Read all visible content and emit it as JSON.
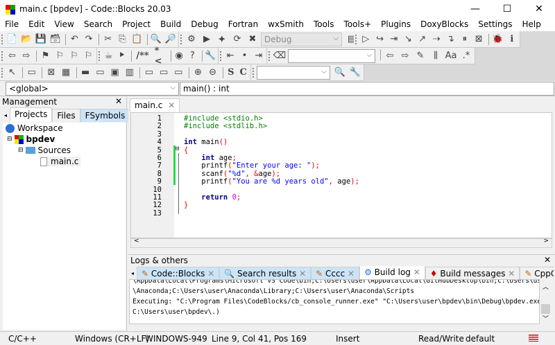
{
  "window": {
    "title": "main.c [bpdev] - Code::Blocks 20.03",
    "minimize": "—",
    "maximize": "☐",
    "close": "✕"
  },
  "menu": [
    "File",
    "Edit",
    "View",
    "Search",
    "Project",
    "Build",
    "Debug",
    "Fortran",
    "wxSmith",
    "Tools",
    "Tools+",
    "Plugins",
    "DoxyBlocks",
    "Settings",
    "Help"
  ],
  "toolbars": {
    "row1a": [
      [
        "new-file-icon",
        "📄"
      ],
      [
        "open-icon",
        "📂"
      ],
      [
        "save-icon",
        "💾"
      ],
      [
        "save-all-icon",
        "🗃"
      ],
      "|",
      [
        "undo-icon",
        "↶"
      ],
      [
        "redo-icon",
        "↷"
      ],
      "|",
      [
        "cut-icon",
        "✂"
      ],
      [
        "copy-icon",
        "⎘"
      ],
      [
        "paste-icon",
        "📋"
      ],
      "|",
      [
        "find-icon",
        "🔍"
      ],
      [
        "replace-icon",
        "🔎"
      ]
    ],
    "row1b": [
      [
        "build-icon",
        "⚙"
      ],
      [
        "run-icon",
        "▶"
      ],
      [
        "build-run-icon",
        "⯌"
      ],
      [
        "rebuild-icon",
        "⟳"
      ],
      [
        "abort-icon",
        "✖"
      ]
    ],
    "build_target": "Debug",
    "row1c": [
      [
        "show-target-icon",
        "▤"
      ]
    ],
    "row1d": [
      [
        "debug-start-icon",
        "▷"
      ],
      [
        "run-to-cursor-icon",
        "↪"
      ],
      [
        "next-line-icon",
        "⇥"
      ],
      [
        "step-into-icon",
        "↘"
      ],
      [
        "step-out-icon",
        "↗"
      ],
      [
        "next-instruction-icon",
        "⇢"
      ],
      [
        "step-into-instruction-icon",
        "↴"
      ],
      [
        "pause-icon",
        "⏸"
      ],
      [
        "stop-debug-icon",
        "⊠"
      ],
      "|",
      [
        "debug-windows-icon",
        "🐞"
      ],
      [
        "info-icon",
        "ℹ"
      ]
    ],
    "row2a": [
      [
        "back-icon",
        "⇦"
      ],
      [
        "forward-icon",
        "⇨"
      ],
      "|",
      [
        "bookmark-toggle-icon",
        "⚑"
      ],
      [
        "bookmark-prev-icon",
        "⚐"
      ],
      [
        "bookmark-next-icon",
        "⚐"
      ],
      [
        "bookmark-clear-icon",
        "⚐"
      ]
    ],
    "row2b": [
      [
        "doxywizard-icon",
        "☕"
      ],
      [
        "extract-docs-icon",
        "⯈"
      ],
      "|",
      [
        "block-comment-label",
        "/**"
      ],
      [
        "line-comment-label",
        "*<"
      ],
      "|",
      [
        "run-html-icon",
        "◉"
      ],
      [
        "run-chm-icon",
        "?"
      ],
      "|",
      [
        "config-icon",
        "🔧"
      ]
    ],
    "row2c": [
      [
        "jump-prev-icon",
        "⇤"
      ],
      [
        "jump-dot-icon",
        "•"
      ],
      [
        "jump-next-icon",
        "⇥"
      ]
    ],
    "row2d": [
      [
        "tag-icon",
        "⌫"
      ]
    ],
    "row2e": [
      "|",
      [
        "search-back-icon",
        "⇦"
      ],
      [
        "search-forward-icon",
        "⇨"
      ],
      [
        "highlight-icon",
        "✎"
      ],
      [
        "selected-text-icon",
        "⫼"
      ],
      [
        "match-case-icon",
        "Aa"
      ],
      [
        "regex-icon",
        ".*"
      ]
    ],
    "row3a": [
      [
        "pointer-icon",
        "↖"
      ],
      "|",
      [
        "frame-icon",
        "▭"
      ],
      "|",
      [
        "static-box-icon",
        "⊠"
      ],
      [
        "grid-icon",
        "▦"
      ],
      "|",
      [
        "panel1-icon",
        "▬"
      ],
      [
        "panel2-icon",
        "▭"
      ],
      [
        "panel3-icon",
        "▣"
      ],
      [
        "panel4-icon",
        "▥"
      ],
      "|",
      [
        "sizer1-icon",
        "▭"
      ],
      [
        "sizer2-icon",
        "▭"
      ],
      [
        "sizer3-icon",
        "▭"
      ],
      "|",
      [
        "zoom-in-icon",
        "⊕"
      ],
      [
        "zoom-out-icon",
        "⊖"
      ],
      "|",
      [
        "s-label",
        "S"
      ],
      [
        "c-label",
        "C"
      ]
    ],
    "row3b": [
      [
        "search-symbol-icon",
        "🔍"
      ],
      [
        "settings-wrench-icon",
        "🔧"
      ]
    ]
  },
  "codecompletion": {
    "scope": "<global>",
    "function": "main() : int"
  },
  "management": {
    "title": "Management",
    "tabs": [
      "Projects",
      "Files",
      "FSymbols"
    ],
    "tree": {
      "workspace": "Workspace",
      "project": "bpdev",
      "folder": "Sources",
      "file": "main.c"
    }
  },
  "editor": {
    "tab": "main.c",
    "lines": [
      [
        [
          "pp",
          "#include <stdio.h>"
        ]
      ],
      [
        [
          "pp",
          "#include <stdlib.h>"
        ]
      ],
      [],
      [
        [
          "k",
          "int"
        ],
        [
          "t",
          " main"
        ],
        [
          "o",
          "()"
        ]
      ],
      [
        [
          "o",
          "{"
        ]
      ],
      [
        [
          "t",
          "    "
        ],
        [
          "k",
          "int"
        ],
        [
          "t",
          " age"
        ],
        [
          "o",
          ";"
        ]
      ],
      [
        [
          "t",
          "    printf"
        ],
        [
          "o",
          "("
        ],
        [
          "s",
          "\"Enter your age: \""
        ],
        [
          "o",
          ");"
        ]
      ],
      [
        [
          "t",
          "    scanf"
        ],
        [
          "o",
          "("
        ],
        [
          "s",
          "\"%d\""
        ],
        [
          "o",
          ", &"
        ],
        [
          "t",
          "age"
        ],
        [
          "o",
          ");"
        ]
      ],
      [
        [
          "t",
          "    printf"
        ],
        [
          "o",
          "("
        ],
        [
          "s",
          "\"You are %d years old\""
        ],
        [
          "o",
          ", "
        ],
        [
          "t",
          "age"
        ],
        [
          "o",
          ");"
        ]
      ],
      [],
      [
        [
          "t",
          "    "
        ],
        [
          "k",
          "return"
        ],
        [
          "t",
          " "
        ],
        [
          "n",
          "0"
        ],
        [
          "o",
          ";"
        ]
      ],
      [
        [
          "o",
          "}"
        ]
      ],
      []
    ]
  },
  "logs": {
    "title": "Logs & others",
    "tabs": [
      [
        "code-blocks-tab",
        "Code::Blocks",
        "✎"
      ],
      [
        "search-results-tab",
        "Search results",
        "🔍"
      ],
      [
        "cccc-tab",
        "Cccc",
        "✎"
      ],
      [
        "build-log-tab",
        "Build log",
        "⚙"
      ],
      [
        "build-messages-tab",
        "Build messages",
        "♦"
      ],
      [
        "cppcheck-tab",
        "CppCheck/Vera++",
        "✎"
      ]
    ],
    "lines": [
      "\\AppData\\Local\\Programs\\Microsoft VS Code\\bin;C:\\Users\\user\\AppData\\Local\\GitHubDesktop\\bin;C:\\Users\\user",
      "\\Anaconda;C:\\Users\\user\\Anaconda\\Library;C:\\Users\\user\\Anaconda\\Scripts",
      "Executing: \"C:\\Program Files\\CodeBlocks/cb_console_runner.exe\" \"C:\\Users\\user\\bpdev\\bin\\Debug\\bpdev.exe\"  (in",
      "C:\\Users\\user\\bpdev\\.)"
    ]
  },
  "status": {
    "language": "C/C++",
    "eol": "Windows (CR+LF)",
    "encoding": "WINDOWS-949",
    "position": "Line 9, Col 41, Pos 169",
    "mode": "Insert",
    "access": "Read/Write",
    "profile": "default"
  }
}
